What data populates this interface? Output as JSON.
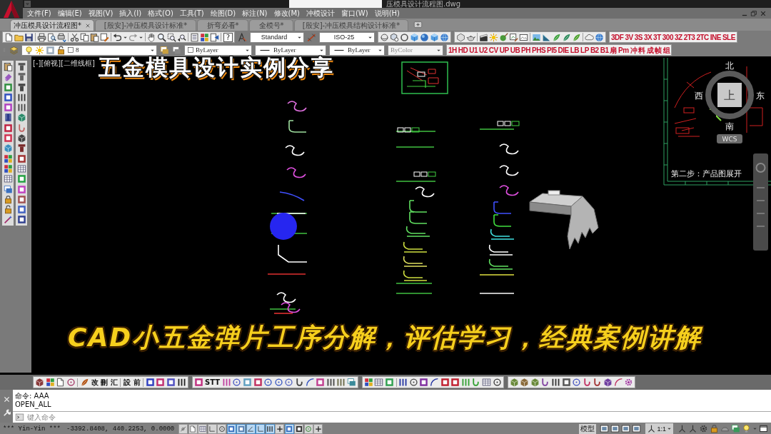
{
  "title_bar": {
    "title": "压模具设计流程图.dwg"
  },
  "menu": [
    "文件(F)",
    "编辑(E)",
    "视图(V)",
    "插入(I)",
    "格式(O)",
    "工具(T)",
    "绘图(D)",
    "标注(N)",
    "修改(M)",
    "冲模设计",
    "窗口(W)",
    "说明(H)"
  ],
  "tabs": [
    {
      "label": "冲压模具设计流程图*",
      "selected": true
    },
    {
      "label": "[殷安]-冲压模具设计标准*",
      "selected": false
    },
    {
      "label": "折弯必看*",
      "selected": false
    },
    {
      "label": "全模号*",
      "selected": false
    },
    {
      "label": "[殷安]-冲压模具结构设计标准*",
      "selected": false
    }
  ],
  "standard_toolbar": {
    "help": "?",
    "text_style": "Standard",
    "dimension_style": "ISO-25",
    "command_buttons": [
      "3DF",
      "3V",
      "3S",
      "3X",
      "3T",
      "300",
      "3Z",
      "2T3",
      "2TC",
      "INE",
      "SLE"
    ]
  },
  "properties_toolbar": {
    "layer": "8",
    "colour_control": "ByLayer",
    "linetype": "ByLayer",
    "lineweight": "ByLayer",
    "plot_style": {
      "value": "ByColor",
      "disabled": true
    },
    "command_buttons": [
      "1H",
      "HD",
      "U1",
      "U2",
      "CV",
      "UP",
      "UB",
      "PH",
      "PHS",
      "PI5",
      "DIE",
      "LB",
      "LP",
      "B2",
      "B1",
      "扇",
      "Pm",
      "冲",
      "料",
      "成",
      "帧",
      "组"
    ]
  },
  "viewport": {
    "label": "[-][俯视][二维线框]",
    "note": "第二步：产品图展开",
    "viewcube": {
      "north": "北",
      "south": "南",
      "east": "东",
      "west": "西",
      "face": "上",
      "coordinate_system": "WCS"
    }
  },
  "captions": {
    "headline": "五金模具设计实例分享",
    "subtitle": "CAD小五金弹片工序分解，评估学习，经典案例讲解"
  },
  "bottom_toolbar": {
    "labels": [
      "改",
      "刪",
      "汇",
      "設",
      "前",
      "STT"
    ]
  },
  "command_line": {
    "history": [
      "命令: AAA",
      "OPEN_ALL"
    ],
    "placeholder": "键入命令"
  },
  "status_bar": {
    "user": "*** Yin-Yin ***",
    "coordinates": "-3392.8408, 440.2253, 0.0000",
    "toggles": [
      {
        "on": false
      },
      {
        "on": false
      },
      {
        "on": false
      },
      {
        "on": false
      },
      {
        "on": false
      },
      {
        "on": true
      },
      {
        "on": true
      },
      {
        "on": true
      },
      {
        "on": true
      },
      {
        "on": true
      },
      {
        "on": false
      },
      {
        "on": true
      },
      {
        "on": false
      },
      {
        "on": false
      },
      {
        "on": false
      }
    ],
    "space": "模型",
    "annotation_scale": "1:1"
  }
}
